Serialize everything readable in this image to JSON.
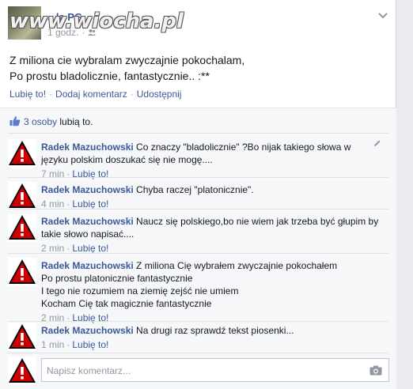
{
  "header": {
    "page_name": "...ła PG",
    "time": "1 godz.",
    "watermark": "www.wiocha.pl",
    "audience_icon": "friends-icon"
  },
  "post": {
    "line1": "Z miliona cie wybralam zwyczajnie pokochalam,",
    "line2": "Po prostu bladolicznie, fantastycznie.. :**"
  },
  "actions": {
    "like": "Lubię to!",
    "comment": "Dodaj komentarz",
    "share": "Udostępnij",
    "separator": "·"
  },
  "likes": {
    "count": "3 osoby",
    "rest": "lubią to."
  },
  "comments": [
    {
      "author": "Radek Mazuchowski",
      "text": "Co znaczy \"bladolicznie\" ?Bo nijak takiego słowa w języku polskim doszukać się nie mogę....",
      "time": "7 min",
      "like": "Lubię to!"
    },
    {
      "author": "Radek Mazuchowski",
      "text": "Chyba raczej \"platonicznie\".",
      "time": "4 min",
      "like": "Lubię to!"
    },
    {
      "author": "Radek Mazuchowski",
      "text": "Naucz się polskiego,bo nie wiem jak trzeba być głupim by takie słowo napisać....",
      "time": "2 min",
      "like": "Lubię to!"
    },
    {
      "author": "Radek Mazuchowski",
      "text": "Z miliona Cię wybrałem zwyczajnie pokochałem",
      "lines": [
        "Po prostu platonicznie fantastycznie",
        "I tego nie rozumiem na ziemię zejść nie umiem",
        "Kocham Cię tak magicznie fantastycznie"
      ],
      "time": "2 min",
      "like": "Lubię to!"
    },
    {
      "author": "Radek Mazuchowski",
      "text": "Na drugi raz sprawdź tekst piosenki...",
      "time": "1 min",
      "like": "Lubię to!"
    }
  ],
  "composer": {
    "placeholder": "Napisz komentarz...",
    "camera_icon": "camera-icon"
  },
  "colors": {
    "link": "#3b5998",
    "meta": "#9197a3",
    "warning_red": "#cc0000"
  }
}
